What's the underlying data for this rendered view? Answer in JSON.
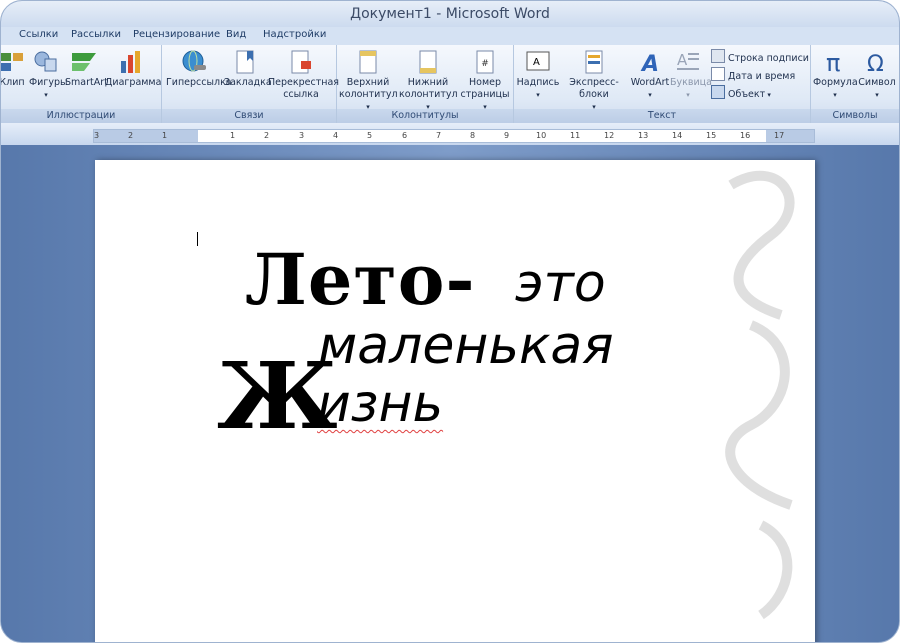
{
  "window": {
    "title": "Документ1 - Microsoft Word"
  },
  "menu_tabs": [
    "Ссылки",
    "Рассылки",
    "Рецензирование",
    "Вид",
    "Надстройки"
  ],
  "ribbon": {
    "illustrations": {
      "caption": "Иллюстрации",
      "clip": "Клип",
      "shapes": "Фигуры",
      "smartart": "SmartArt",
      "chart": "Диаграмма"
    },
    "links": {
      "caption": "Связи",
      "hyperlink": "Гиперссылка",
      "bookmark": "Закладка",
      "crossref_1": "Перекрестная",
      "crossref_2": "ссылка"
    },
    "headers": {
      "caption": "Колонтитулы",
      "header_1": "Верхний",
      "header_2": "колонтитул",
      "footer_1": "Нижний",
      "footer_2": "колонтитул",
      "pagenum_1": "Номер",
      "pagenum_2": "страницы"
    },
    "text": {
      "caption": "Текст",
      "textbox": "Надпись",
      "quickparts": "Экспресс-блоки",
      "wordart": "WordArt",
      "dropcap": "Буквица",
      "signature_line": "Строка подписи",
      "datetime": "Дата и время",
      "object": "Объект"
    },
    "symbols": {
      "caption": "Символы",
      "equation": "Формула",
      "symbol": "Символ"
    }
  },
  "ruler": {
    "ticks": [
      "3",
      "2",
      "1",
      "1",
      "2",
      "3",
      "4",
      "5",
      "6",
      "7",
      "8",
      "9",
      "10",
      "11",
      "12",
      "13",
      "14",
      "15",
      "16",
      "17"
    ]
  },
  "document": {
    "line1_bold": "Лето-",
    "line1_script": "это",
    "line2": "маленькая",
    "line3_capital": "Ж",
    "line3": "изнь"
  },
  "colors": {
    "ribbon_bg": "#dfe9f6",
    "doc_bg": "#6f8fbe",
    "spell_underline": "#e04040"
  }
}
